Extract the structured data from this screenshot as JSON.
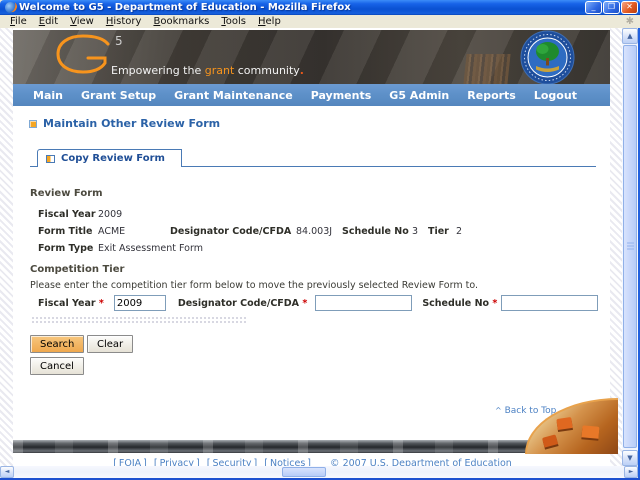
{
  "window": {
    "title": "Welcome to G5 - Department of Education - Mozilla Firefox",
    "menu_items": [
      "File",
      "Edit",
      "View",
      "History",
      "Bookmarks",
      "Tools",
      "Help"
    ]
  },
  "header": {
    "logo_sup": "5",
    "tagline_prefix": "Empowering the ",
    "tagline_accent": "grant",
    "tagline_suffix": " community",
    "tagline_period": "."
  },
  "nav": {
    "items": [
      "Main",
      "Grant Setup",
      "Grant Maintenance",
      "Payments",
      "G5 Admin",
      "Reports",
      "Logout"
    ]
  },
  "main": {
    "page_heading": "Maintain Other Review Form",
    "tab_label": "Copy Review Form",
    "review_form": {
      "title": "Review Form",
      "fiscal_year_label": "Fiscal Year",
      "fiscal_year_value": "2009",
      "form_title_label": "Form Title",
      "form_title_value": "ACME",
      "designator_label": "Designator Code/CFDA",
      "designator_value": "84.003J",
      "schedule_label": "Schedule No",
      "schedule_value": "3",
      "tier_label": "Tier",
      "tier_value": "2",
      "form_type_label": "Form Type",
      "form_type_value": "Exit Assessment Form"
    },
    "competition_tier": {
      "title": "Competition Tier",
      "instruction": "Please enter the competition tier form below to move the previously selected Review Form to.",
      "required_marker": "*",
      "fiscal_year_label": "Fiscal Year",
      "fiscal_year_value": "2009",
      "designator_label": "Designator Code/CFDA",
      "designator_value": "",
      "schedule_label": "Schedule No",
      "schedule_value": ""
    },
    "buttons": {
      "search": "Search",
      "clear": "Clear",
      "cancel": "Cancel"
    }
  },
  "footer": {
    "back_to_top_caret": "^",
    "back_to_top": "Back to Top",
    "bracket_open": "[",
    "bracket_close": "]",
    "links": [
      "FOIA",
      "Privacy",
      "Security",
      "Notices"
    ],
    "copyright": "©  2007  U.S.  Department  of  Education"
  },
  "glyphs": {
    "minimize": "_",
    "restore": "❐",
    "close": "✕",
    "throbber": "✱",
    "scroll_up": "▲",
    "scroll_down": "▼",
    "scroll_left": "◄",
    "scroll_right": "►"
  },
  "colors": {
    "titlebar_blue": "#0A51D2",
    "nav_blue": "#5E91C9",
    "accent_orange": "#F7941D",
    "heading_blue": "#2B62A7",
    "link_blue": "#4D82C4",
    "required_red": "#CC0000",
    "search_button_orange": "#EFA84E"
  }
}
